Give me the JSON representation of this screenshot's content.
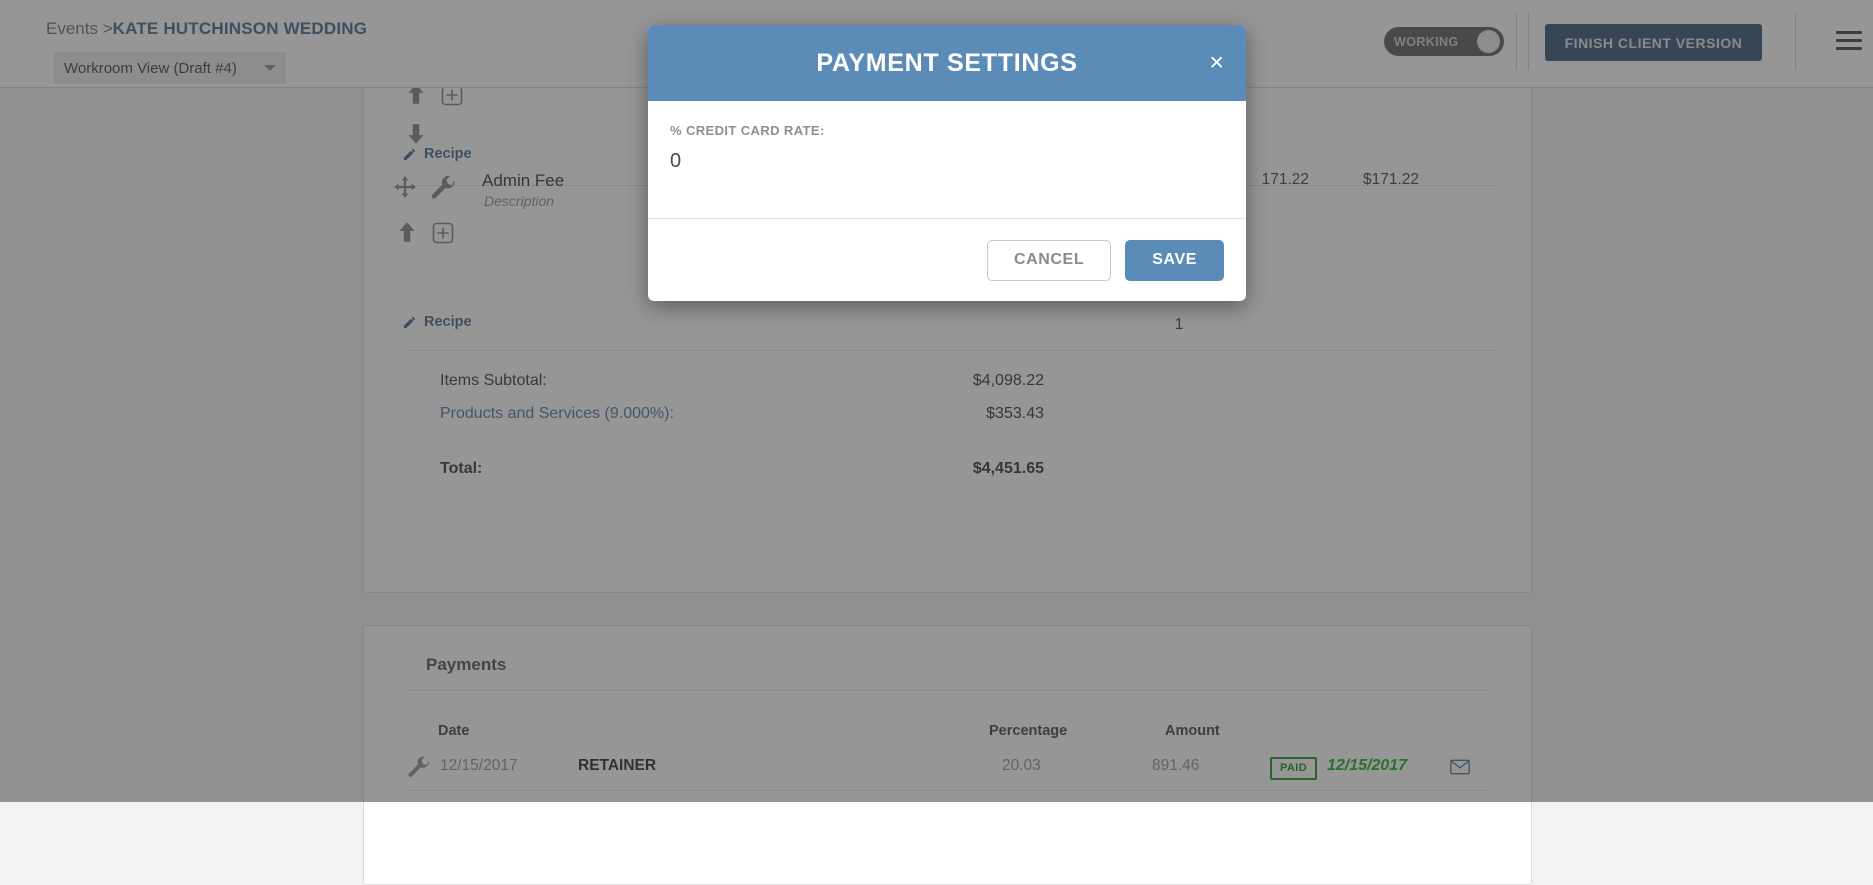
{
  "header": {
    "breadcrumb_root": "Events ",
    "breadcrumb_sep": ">",
    "breadcrumb_current": "KATE HUTCHINSON WEDDING",
    "view_select_value": "Workroom View (Draft #4)",
    "working_toggle_label": "WORKING",
    "finish_button_label": "FINISH CLIENT VERSION",
    "menu_icon": "hamburger-icon"
  },
  "items": {
    "recipe_link_top": "Recipe",
    "recipe_link_bottom": "Recipe",
    "row": {
      "name": "Admin Fee",
      "description": "Description",
      "unit_price": "171.22",
      "total": "$171.22",
      "quantity": "1"
    },
    "icons": {
      "move": "move-arrows-icon",
      "wrench": "wrench-icon",
      "arrow_up": "arrow-up-icon",
      "arrow_down": "arrow-down-icon",
      "add": "plus-box-icon",
      "edit": "pencil-icon"
    }
  },
  "totals": {
    "subtotal_label": "Items Subtotal:",
    "subtotal_value": "$4,098.22",
    "tax_label": "Products and Services (9.000%):",
    "tax_value": "$353.43",
    "total_label": "Total:",
    "total_value": "$4,451.65"
  },
  "payments": {
    "section_title": "Payments",
    "columns": [
      "Date",
      "Percentage",
      "Amount"
    ],
    "rows": [
      {
        "date": "12/15/2017",
        "name": "RETAINER",
        "percentage": "20.03",
        "amount": "891.46",
        "status": "PAID",
        "paid_date": "12/15/2017",
        "wrench_icon": "wrench-icon",
        "email_icon": "envelope-icon"
      }
    ]
  },
  "modal": {
    "title": "PAYMENT SETTINGS",
    "close_label": "×",
    "field_label": "% CREDIT CARD RATE:",
    "field_value": "0",
    "field_placeholder": "0",
    "cancel_label": "CANCEL",
    "save_label": "SAVE"
  },
  "colors": {
    "modal_header": "#5b8cb8",
    "primary_button": "#5b8cb8",
    "finish_button": "#2c4e70",
    "link": "#3f6388",
    "paid_green": "#138b13",
    "paid_date_green": "#0fae0f"
  }
}
